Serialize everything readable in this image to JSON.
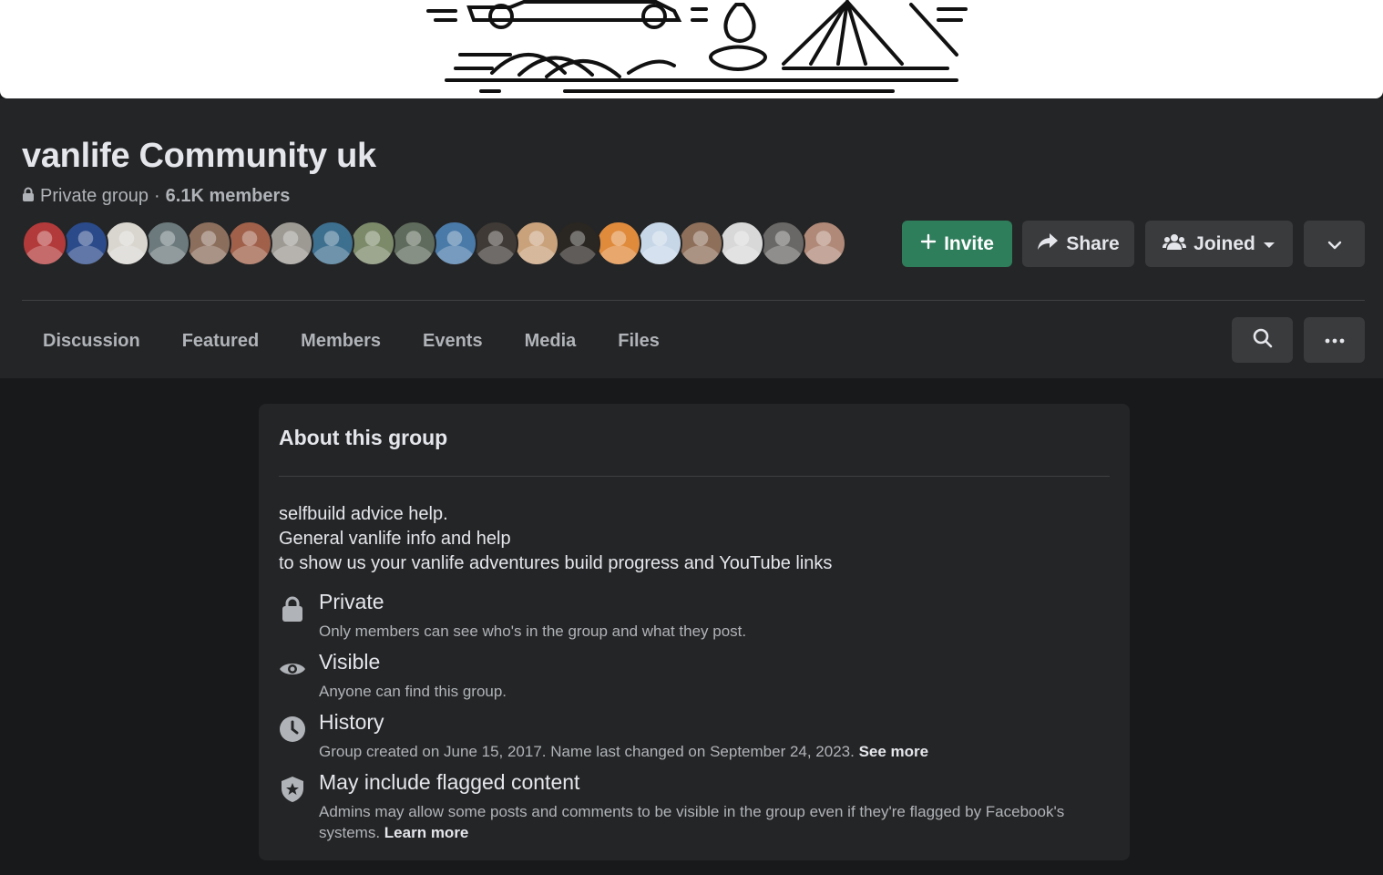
{
  "group": {
    "name": "vanlife Community uk",
    "privacy": "Private group",
    "separator": "·",
    "members": "6.1K members"
  },
  "avatars": [
    {
      "color": "#b33a3a"
    },
    {
      "color": "#2b4a8a"
    },
    {
      "color": "#d9d6d0"
    },
    {
      "color": "#6c7a7d"
    },
    {
      "color": "#8c6e5d"
    },
    {
      "color": "#a0604a"
    },
    {
      "color": "#9d9a94"
    },
    {
      "color": "#3d6f8f"
    },
    {
      "color": "#7c8a6a"
    },
    {
      "color": "#5f6b5c"
    },
    {
      "color": "#4a7aa8"
    },
    {
      "color": "#3f3a36"
    },
    {
      "color": "#c9a27c"
    },
    {
      "color": "#2a2622"
    },
    {
      "color": "#e08a3c"
    },
    {
      "color": "#c7d7e8"
    },
    {
      "color": "#8e6f5a"
    },
    {
      "color": "#d8d8d8"
    },
    {
      "color": "#6a6866"
    },
    {
      "color": "#b08978"
    }
  ],
  "actions": {
    "invite": "Invite",
    "share": "Share",
    "joined": "Joined"
  },
  "tabs": [
    "Discussion",
    "Featured",
    "Members",
    "Events",
    "Media",
    "Files"
  ],
  "about": {
    "title": "About this group",
    "description": [
      "selfbuild advice help.",
      "General vanlife info and help",
      "to show us your vanlife adventures build progress and YouTube links"
    ],
    "items": [
      {
        "icon": "lock-icon",
        "title": "Private",
        "text": "Only members can see who's in the group and what they post.",
        "link": ""
      },
      {
        "icon": "eye-icon",
        "title": "Visible",
        "text": "Anyone can find this group.",
        "link": ""
      },
      {
        "icon": "clock-icon",
        "title": "History",
        "text": "Group created on June 15, 2017. Name last changed on September 24, 2023. ",
        "link": "See more"
      },
      {
        "icon": "shield-star-icon",
        "title": "May include flagged content",
        "text": "Admins may allow some posts and comments to be visible in the group even if they're flagged by Facebook's systems. ",
        "link": "Learn more"
      }
    ]
  },
  "colors": {
    "background": "#18191a",
    "surface": "#242526",
    "button": "#3a3b3c",
    "accent": "#2e7d5b",
    "text": "#e4e6eb",
    "secondary": "#b0b3b8"
  }
}
